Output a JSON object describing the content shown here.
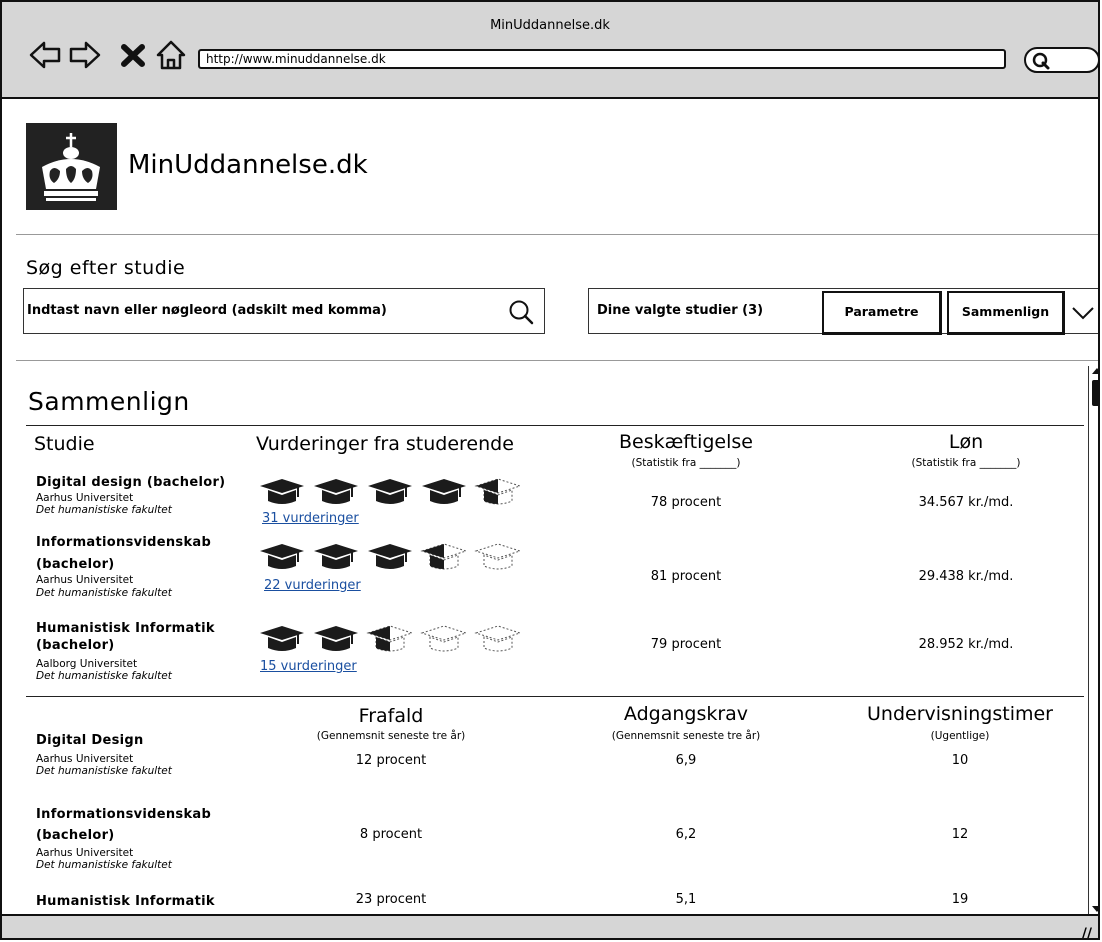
{
  "browser": {
    "title": "MinUddannelse.dk",
    "url": "http://www.minuddannelse.dk"
  },
  "site": {
    "name": "MinUddannelse.dk"
  },
  "search": {
    "label": "Søg efter studie",
    "placeholder": "Indtast navn eller nøgleord (adskilt med komma)"
  },
  "selection": {
    "label": "Dine valgte studier (3)",
    "params_button": "Parametre",
    "compare_button": "Sammenlign"
  },
  "compare": {
    "heading": "Sammenlign",
    "table1": {
      "headers": {
        "studie": "Studie",
        "ratings": "Vurderinger fra studerende",
        "employment": "Beskæftigelse",
        "employment_sub": "(Statistik fra _______)",
        "salary": "Løn",
        "salary_sub": "(Statistik fra _______)"
      },
      "rows": [
        {
          "name_line1": "Digital design (bachelor)",
          "name_line2": "",
          "university": "Aarhus Universitet",
          "faculty": "Det humanistiske fakultet",
          "rating": 4.5,
          "ratings_link": "31 vurderinger",
          "employment": "78 procent",
          "salary": "34.567 kr./md."
        },
        {
          "name_line1": "Informationsvidenskab",
          "name_line2": "(bachelor)",
          "university": "Aarhus Universitet",
          "faculty": "Det humanistiske fakultet",
          "rating": 3.5,
          "ratings_link": "22 vurderinger",
          "employment": "81 procent",
          "salary": "29.438 kr./md."
        },
        {
          "name_line1": "Humanistisk Informatik",
          "name_line2": "(bachelor)",
          "university": "Aalborg Universitet",
          "faculty": "Det humanistiske fakultet",
          "rating": 2.5,
          "ratings_link": "15 vurderinger",
          "employment": "79 procent",
          "salary": "28.952 kr./md."
        }
      ]
    },
    "table2": {
      "headers": {
        "dropout": "Frafald",
        "dropout_sub": "(Gennemsnit seneste tre år)",
        "admission": "Adgangskrav",
        "admission_sub": "(Gennemsnit seneste tre år)",
        "hours": "Undervisningstimer",
        "hours_sub": "(Ugentlige)"
      },
      "rows": [
        {
          "name_line1": "Digital Design",
          "name_line2": "",
          "university": "Aarhus Universitet",
          "faculty": "Det humanistiske fakultet",
          "dropout": "12 procent",
          "admission": "6,9",
          "hours": "10"
        },
        {
          "name_line1": "Informationsvidenskab",
          "name_line2": "(bachelor)",
          "university": "Aarhus Universitet",
          "faculty": "Det humanistiske fakultet",
          "dropout": "8 procent",
          "admission": "6,2",
          "hours": "12"
        },
        {
          "name_line1": "Humanistisk Informatik",
          "name_line2": "",
          "university": "",
          "faculty": "",
          "dropout": "23 procent",
          "admission": "5,1",
          "hours": "19"
        }
      ]
    }
  },
  "icons": {
    "back": "arrow-left-icon",
    "forward": "arrow-right-icon",
    "stop": "close-icon",
    "home": "home-icon",
    "search": "search-icon",
    "logo": "crown-icon",
    "rating": "graduation-cap-icon",
    "dropdown": "chevron-down-icon"
  }
}
